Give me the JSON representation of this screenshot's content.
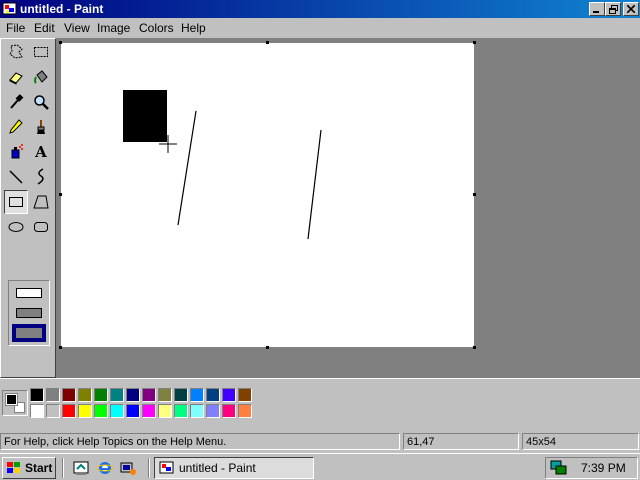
{
  "window": {
    "title": "untitled - Paint",
    "controls": [
      "minimize-icon",
      "maximize-icon",
      "close-icon"
    ]
  },
  "menu": {
    "items": [
      "File",
      "Edit",
      "View",
      "Image",
      "Colors",
      "Help"
    ]
  },
  "toolbox": {
    "tools": [
      "free-form-select-icon",
      "rect-select-icon",
      "eraser-icon",
      "fill-bucket-icon",
      "color-picker-icon",
      "magnifier-icon",
      "pencil-icon",
      "brush-icon",
      "airbrush-icon",
      "text-icon",
      "line-icon",
      "curve-icon",
      "rectangle-icon",
      "polygon-icon",
      "ellipse-icon",
      "rounded-rect-icon"
    ],
    "active_tool": "rectangle-icon",
    "text_tool_glyph": "A",
    "fill_styles": [
      "outline",
      "outline-and-fill",
      "fill"
    ],
    "selected_fill_style": "fill"
  },
  "palette": {
    "foreground": "#000000",
    "background": "#ffffff",
    "colors_row1": [
      "#000000",
      "#808080",
      "#800000",
      "#808000",
      "#008000",
      "#008080",
      "#000080",
      "#800080",
      "#808040",
      "#004040",
      "#0080ff",
      "#004080",
      "#4000ff",
      "#804000"
    ],
    "colors_row2": [
      "#ffffff",
      "#c0c0c0",
      "#ff0000",
      "#ffff00",
      "#00ff00",
      "#00ffff",
      "#0000ff",
      "#ff00ff",
      "#ffff80",
      "#00ff80",
      "#80ffff",
      "#8080ff",
      "#ff0080",
      "#ff8040"
    ]
  },
  "status": {
    "help_text": "For Help, click Help Topics on the Help Menu.",
    "coordinates": "61,47",
    "selection_size": "45x54"
  },
  "taskbar": {
    "start_label": "Start",
    "quick_launch": [
      "desktop-icon",
      "internet-explorer-icon",
      "channels-icon"
    ],
    "task_label": "untitled - Paint",
    "clock": "7:39 PM"
  }
}
